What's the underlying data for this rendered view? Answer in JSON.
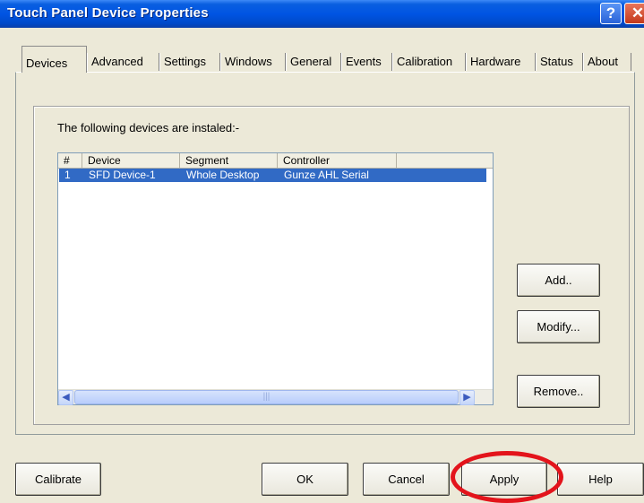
{
  "window": {
    "title": "Touch Panel Device Properties",
    "help_glyph": "?",
    "close_glyph": "✕"
  },
  "tabs": [
    {
      "label": "Devices"
    },
    {
      "label": "Advanced"
    },
    {
      "label": "Settings"
    },
    {
      "label": "Windows"
    },
    {
      "label": "General"
    },
    {
      "label": "Events"
    },
    {
      "label": "Calibration"
    },
    {
      "label": "Hardware"
    },
    {
      "label": "Status"
    },
    {
      "label": "About"
    }
  ],
  "devices_panel": {
    "installed_label": "The following devices are instaled:-",
    "columns": [
      "#",
      "Device",
      "Segment",
      "Controller"
    ],
    "rows": [
      {
        "num": "1",
        "device": "SFD Device-1",
        "segment": "Whole Desktop",
        "controller": "Gunze AHL Serial"
      }
    ],
    "scroll_left": "◀",
    "scroll_right": "▶",
    "scroll_thumb_grip": "|||",
    "add_label": "Add..",
    "modify_label": "Modify...",
    "remove_label": "Remove.."
  },
  "footer": {
    "calibrate_label": "Calibrate",
    "ok_label": "OK",
    "cancel_label": "Cancel",
    "apply_label": "Apply",
    "help_label": "Help"
  },
  "colors": {
    "titlebar": "#0054e3",
    "selection": "#316ac5",
    "annotation": "#e3141b",
    "dialog_face": "#ece9d8"
  },
  "icons": {
    "help": "question-mark-icon",
    "close": "close-icon",
    "scroll_left": "arrow-left-icon",
    "scroll_right": "arrow-right-icon"
  }
}
